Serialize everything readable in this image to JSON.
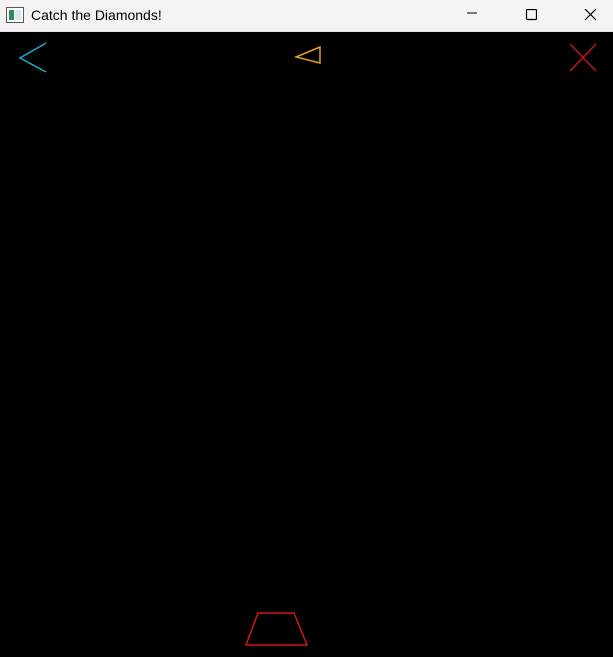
{
  "window": {
    "title": "Catch the Diamonds!",
    "controls": {
      "minimize": "minimize",
      "maximize": "maximize",
      "close": "close"
    }
  },
  "game": {
    "colors": {
      "background": "#000000",
      "back_arrow": "#1ab0c8",
      "diamond": "#e0a21c",
      "exit_cross": "#c01818",
      "catcher": "#d01818"
    },
    "icons": {
      "back": "chevron-left-icon",
      "diamond": "diamond-icon",
      "exit": "close-icon",
      "catcher": "trapezoid-catcher"
    }
  }
}
